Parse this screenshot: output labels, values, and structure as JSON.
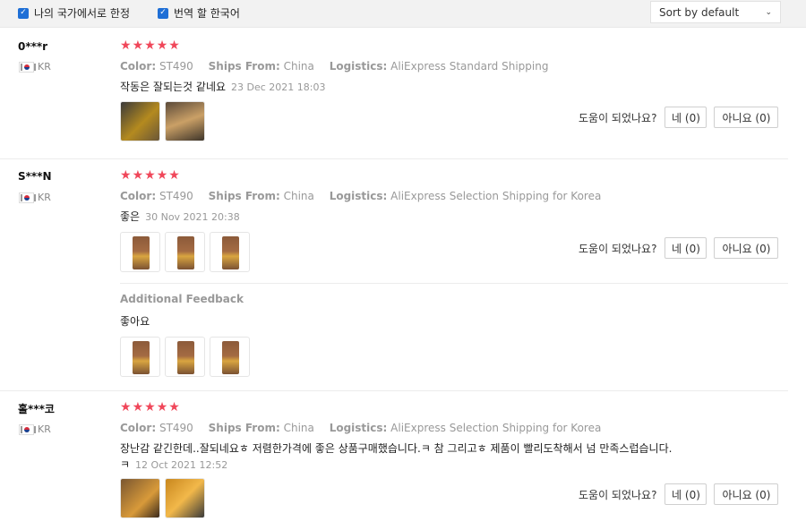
{
  "filters": {
    "local_only_label": "나의 국가에서로 한정",
    "translate_label": "번역 할 한국어",
    "sort_value": "Sort by default"
  },
  "helpful_prompt": "도움이 되었나요?",
  "yes_label": "네 (0)",
  "no_label": "아니요 (0)",
  "labels": {
    "color": "Color:",
    "ships_from": "Ships From:",
    "logistics": "Logistics:",
    "additional_feedback": "Additional Feedback"
  },
  "star_glyph": "★",
  "rating_max": 5,
  "reviews": [
    {
      "user": "0***r",
      "country": "KR",
      "rating": 5,
      "color": "ST490",
      "ships_from": "China",
      "logistics": "AliExpress Standard Shipping",
      "text": "작동은 잘되는것 같네요",
      "date": "23 Dec 2021 18:03",
      "images": 2
    },
    {
      "user": "S***N",
      "country": "KR",
      "rating": 5,
      "color": "ST490",
      "ships_from": "China",
      "logistics": "AliExpress Selection Shipping for Korea",
      "text": "좋은",
      "date": "30 Nov 2021 20:38",
      "images": 3,
      "additional_text": "좋아요",
      "additional_images": 3
    },
    {
      "user": "홀***코",
      "country": "KR",
      "rating": 5,
      "color": "ST490",
      "ships_from": "China",
      "logistics": "AliExpress Selection Shipping for Korea",
      "text_line1": "장난감 같긴한데..잘되네요ㅎ 저렴한가격에 좋은 상품구매했습니다.ㅋ 참 그리고ㅎ 제품이 빨리도착해서 넘 만족스럽습니다.",
      "text_line2": "ㅋ",
      "date": "12 Oct 2021 12:52",
      "images": 2
    }
  ],
  "colors": {
    "accent": "#1f6fd6",
    "star": "#f0475a"
  }
}
